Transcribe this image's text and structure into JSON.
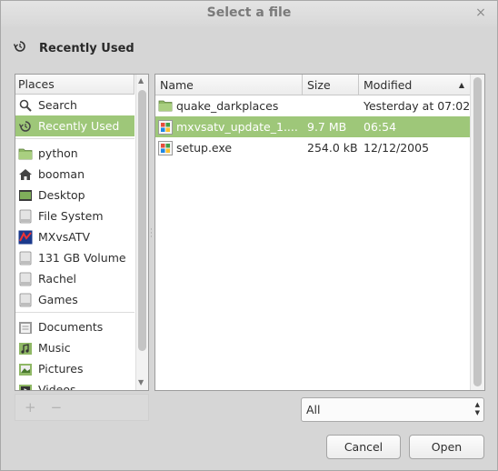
{
  "window": {
    "title": "Select a file",
    "close_glyph": "×"
  },
  "location": {
    "icon": "recent-icon",
    "label": "Recently Used"
  },
  "places": {
    "header": "Places",
    "groups": [
      [
        {
          "label": "Search",
          "icon": "search-icon",
          "selected": false
        },
        {
          "label": "Recently Used",
          "icon": "recent-icon",
          "selected": true
        }
      ],
      [
        {
          "label": "python",
          "icon": "folder-icon",
          "selected": false
        },
        {
          "label": "booman",
          "icon": "home-icon",
          "selected": false
        },
        {
          "label": "Desktop",
          "icon": "desktop-icon",
          "selected": false
        },
        {
          "label": "File System",
          "icon": "drive-icon",
          "selected": false
        },
        {
          "label": "MXvsATV",
          "icon": "mxvsatv-icon",
          "selected": false
        },
        {
          "label": "131 GB Volume",
          "icon": "drive-icon",
          "selected": false
        },
        {
          "label": "Rachel",
          "icon": "drive-icon",
          "selected": false
        },
        {
          "label": "Games",
          "icon": "drive-icon",
          "selected": false
        }
      ],
      [
        {
          "label": "Documents",
          "icon": "documents-folder-icon",
          "selected": false
        },
        {
          "label": "Music",
          "icon": "music-folder-icon",
          "selected": false
        },
        {
          "label": "Pictures",
          "icon": "pictures-folder-icon",
          "selected": false
        },
        {
          "label": "Videos",
          "icon": "videos-folder-icon",
          "selected": false
        }
      ]
    ],
    "add_glyph": "+",
    "remove_glyph": "−"
  },
  "files": {
    "columns": {
      "name": "Name",
      "size": "Size",
      "modified": "Modified"
    },
    "rows": [
      {
        "name": "quake_darkplaces",
        "size": "",
        "modified": "Yesterday at 07:02",
        "icon": "folder-icon",
        "selected": false
      },
      {
        "name": "mxvsatv_update_1....",
        "size": "9.7 MB",
        "modified": "06:54",
        "icon": "exe-icon",
        "selected": true
      },
      {
        "name": "setup.exe",
        "size": "254.0 kB",
        "modified": "12/12/2005",
        "icon": "exe-icon",
        "selected": false
      }
    ]
  },
  "filter": {
    "value": "All"
  },
  "buttons": {
    "cancel": "Cancel",
    "open": "Open"
  },
  "colors": {
    "selection": "#9ec779",
    "folder": "#8fb865"
  }
}
